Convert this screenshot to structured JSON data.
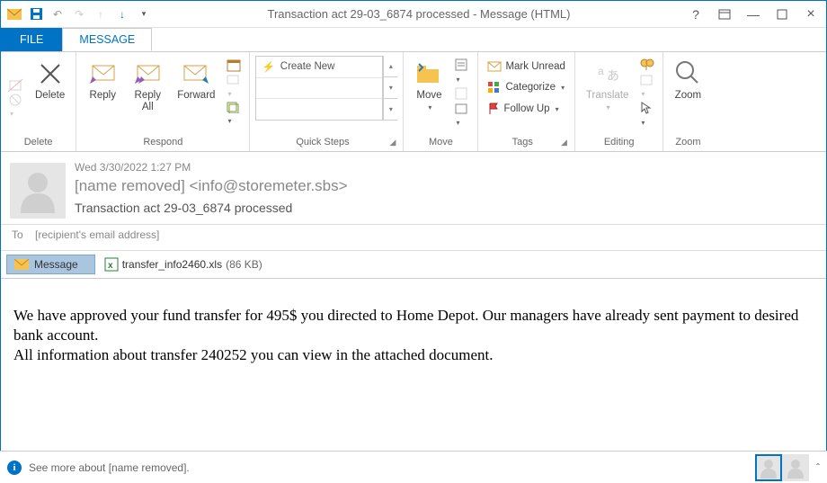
{
  "window": {
    "title": "Transaction act 29-03_6874  processed - Message (HTML)"
  },
  "tabs": {
    "file": "FILE",
    "message": "MESSAGE"
  },
  "ribbon": {
    "delete": {
      "label": "Delete",
      "group": "Delete"
    },
    "respond": {
      "reply": "Reply",
      "replyAll": "Reply\nAll",
      "forward": "Forward",
      "group": "Respond"
    },
    "quicksteps": {
      "createNew": "Create New",
      "group": "Quick Steps"
    },
    "move": {
      "move": "Move",
      "group": "Move"
    },
    "tags": {
      "markUnread": "Mark Unread",
      "categorize": "Categorize",
      "followUp": "Follow Up",
      "group": "Tags"
    },
    "editing": {
      "translate": "Translate",
      "group": "Editing"
    },
    "zoom": {
      "zoom": "Zoom",
      "group": "Zoom"
    }
  },
  "message": {
    "date": "Wed 3/30/2022 1:27 PM",
    "from": "[name removed] <info@storemeter.sbs>",
    "subject": "Transaction act 29-03_6874  processed",
    "toLabel": "To",
    "toValue": "[recipient's email address]",
    "tabLabel": "Message",
    "attachment": {
      "name": "transfer_info2460.xls",
      "size": "(86 KB)"
    },
    "body1": " We have approved your fund transfer for 495$ you directed to Home Depot. Our managers have already sent payment to desired bank account.",
    "body2": "All information about transfer 240252 you can view in the attached document."
  },
  "status": {
    "text": "See more about [name removed]."
  }
}
